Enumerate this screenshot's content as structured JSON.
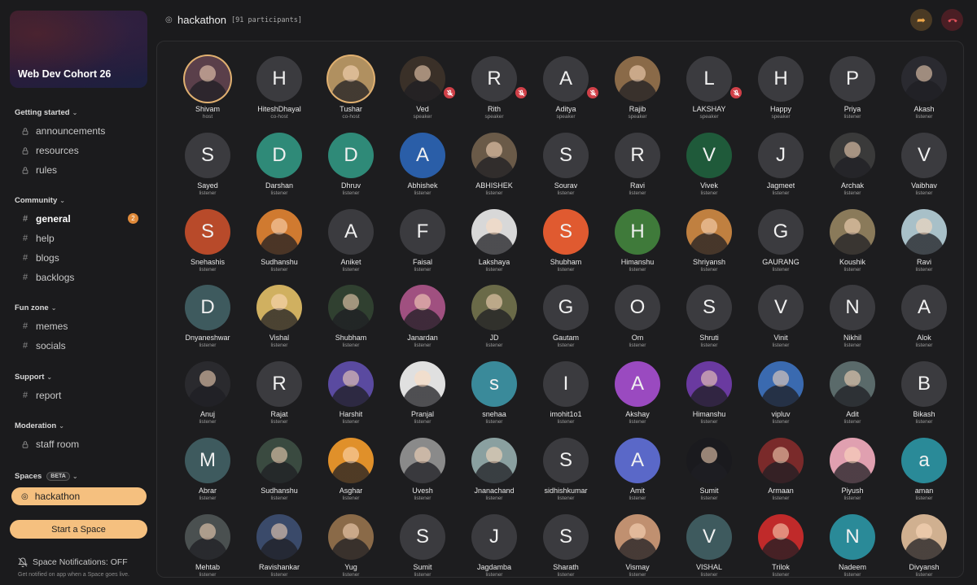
{
  "sidebar": {
    "server_name": "Web Dev Cohort 26",
    "categories": [
      {
        "label": "Getting started",
        "channels": [
          {
            "label": "announcements",
            "icon": "lock-icon"
          },
          {
            "label": "resources",
            "icon": "lock-icon"
          },
          {
            "label": "rules",
            "icon": "lock-icon"
          }
        ]
      },
      {
        "label": "Community",
        "channels": [
          {
            "label": "general",
            "icon": "hash-icon",
            "badge": "2",
            "active": true
          },
          {
            "label": "help",
            "icon": "hash-icon"
          },
          {
            "label": "blogs",
            "icon": "hash-icon"
          },
          {
            "label": "backlogs",
            "icon": "hash-icon"
          }
        ]
      },
      {
        "label": "Fun zone",
        "channels": [
          {
            "label": "memes",
            "icon": "hash-icon"
          },
          {
            "label": "socials",
            "icon": "hash-icon"
          }
        ]
      },
      {
        "label": "Support",
        "channels": [
          {
            "label": "report",
            "icon": "hash-icon"
          }
        ]
      },
      {
        "label": "Moderation",
        "channels": [
          {
            "label": "staff room",
            "icon": "lock-icon"
          }
        ]
      }
    ],
    "spaces": {
      "label": "Spaces",
      "beta": "BETA",
      "items": [
        {
          "label": "hackathon",
          "icon": "broadcast-icon",
          "active": true
        }
      ]
    },
    "start_space_label": "Start a Space",
    "notifications": {
      "label": "Space Notifications: OFF",
      "sub": "Get notified on app when a Space goes live."
    }
  },
  "header": {
    "title": "hackathon",
    "participants": "[91 participants]",
    "share_icon": "share-arrow-icon",
    "leave_icon": "hang-up-icon"
  },
  "colors": {
    "accent": "#f5c07f",
    "badge": "#e08a3a",
    "mute": "#d04048",
    "share": "#f0a94a",
    "hangup": "#e0505a"
  },
  "participants": [
    {
      "name": "Shivam",
      "role": "host",
      "initial": "",
      "photo": true,
      "ring": true,
      "bg": "#5a3f4a"
    },
    {
      "name": "HiteshDhayal",
      "role": "co-host",
      "initial": "H",
      "bg": "#3b3b3f"
    },
    {
      "name": "Tushar",
      "role": "co-host",
      "initial": "",
      "photo": true,
      "ring": true,
      "bg": "#b09060"
    },
    {
      "name": "Ved",
      "role": "speaker",
      "initial": "",
      "photo": true,
      "muted": true,
      "bg": "#3a3028"
    },
    {
      "name": "Rith",
      "role": "speaker",
      "initial": "R",
      "muted": true,
      "bg": "#3b3b3f"
    },
    {
      "name": "Aditya",
      "role": "speaker",
      "initial": "A",
      "muted": true,
      "bg": "#3b3b3f"
    },
    {
      "name": "Rajib",
      "role": "speaker",
      "initial": "",
      "photo": true,
      "bg": "#8a6a48"
    },
    {
      "name": "LAKSHAY",
      "role": "speaker",
      "initial": "L",
      "muted": true,
      "bg": "#3b3b3f"
    },
    {
      "name": "Happy",
      "role": "speaker",
      "initial": "H",
      "bg": "#3b3b3f"
    },
    {
      "name": "Priya",
      "role": "listener",
      "initial": "P",
      "bg": "#3b3b3f"
    },
    {
      "name": "Akash",
      "role": "listener",
      "initial": "",
      "photo": true,
      "bg": "#2a2a30"
    },
    {
      "name": "Sayed",
      "role": "listener",
      "initial": "S",
      "bg": "#3b3b3f"
    },
    {
      "name": "Darshan",
      "role": "listener",
      "initial": "D",
      "bg": "#2f8a78"
    },
    {
      "name": "Dhruv",
      "role": "listener",
      "initial": "D",
      "bg": "#2f8a78"
    },
    {
      "name": "Abhishek",
      "role": "listener",
      "initial": "A",
      "bg": "#2a5ea8"
    },
    {
      "name": "ABHISHEK",
      "role": "listener",
      "initial": "",
      "photo": true,
      "bg": "#6a5a48"
    },
    {
      "name": "Sourav",
      "role": "listener",
      "initial": "S",
      "bg": "#3b3b3f"
    },
    {
      "name": "Ravi",
      "role": "listener",
      "initial": "R",
      "bg": "#3b3b3f"
    },
    {
      "name": "Vivek",
      "role": "listener",
      "initial": "V",
      "bg": "#1f5a3a"
    },
    {
      "name": "Jagmeet",
      "role": "listener",
      "initial": "J",
      "bg": "#3b3b3f"
    },
    {
      "name": "Archak",
      "role": "listener",
      "initial": "",
      "photo": true,
      "bg": "#3a3a3a"
    },
    {
      "name": "Vaibhav",
      "role": "listener",
      "initial": "V",
      "bg": "#3b3b3f"
    },
    {
      "name": "Snehashis",
      "role": "listener",
      "initial": "S",
      "bg": "#b84a2a"
    },
    {
      "name": "Sudhanshu",
      "role": "listener",
      "initial": "",
      "photo": true,
      "bg": "#d07a30"
    },
    {
      "name": "Aniket",
      "role": "listener",
      "initial": "A",
      "bg": "#3b3b3f"
    },
    {
      "name": "Faisal",
      "role": "listener",
      "initial": "F",
      "bg": "#3b3b3f"
    },
    {
      "name": "Lakshaya",
      "role": "listener",
      "initial": "",
      "photo": true,
      "bg": "#d8d8d8"
    },
    {
      "name": "Shubham",
      "role": "listener",
      "initial": "S",
      "bg": "#e05a30"
    },
    {
      "name": "Himanshu",
      "role": "listener",
      "initial": "H",
      "bg": "#3f7a3a"
    },
    {
      "name": "Shriyansh",
      "role": "listener",
      "initial": "",
      "photo": true,
      "bg": "#c08040"
    },
    {
      "name": "GAURANG",
      "role": "listener",
      "initial": "G",
      "bg": "#3b3b3f"
    },
    {
      "name": "Koushik",
      "role": "listener",
      "initial": "",
      "photo": true,
      "bg": "#8a7a5a"
    },
    {
      "name": "Ravi",
      "role": "listener",
      "initial": "",
      "photo": true,
      "bg": "#a8c0c8"
    },
    {
      "name": "Dnyaneshwar",
      "role": "listener",
      "initial": "D",
      "bg": "#3e5a5e"
    },
    {
      "name": "Vishal",
      "role": "listener",
      "initial": "",
      "photo": true,
      "bg": "#d0b060"
    },
    {
      "name": "Shubham",
      "role": "listener",
      "initial": "",
      "photo": true,
      "bg": "#304030"
    },
    {
      "name": "Janardan",
      "role": "listener",
      "initial": "",
      "photo": true,
      "bg": "#a05080"
    },
    {
      "name": "JD",
      "role": "listener",
      "initial": "",
      "photo": true,
      "bg": "#6a6a48"
    },
    {
      "name": "Gautam",
      "role": "listener",
      "initial": "G",
      "bg": "#3b3b3f"
    },
    {
      "name": "Om",
      "role": "listener",
      "initial": "O",
      "bg": "#3b3b3f"
    },
    {
      "name": "Shruti",
      "role": "listener",
      "initial": "S",
      "bg": "#3b3b3f"
    },
    {
      "name": "Vinit",
      "role": "listener",
      "initial": "V",
      "bg": "#3b3b3f"
    },
    {
      "name": "Nikhil",
      "role": "listener",
      "initial": "N",
      "bg": "#3b3b3f"
    },
    {
      "name": "Alok",
      "role": "listener",
      "initial": "A",
      "bg": "#3b3b3f"
    },
    {
      "name": "Anuj",
      "role": "listener",
      "initial": "",
      "photo": true,
      "bg": "#2a2a2e"
    },
    {
      "name": "Rajat",
      "role": "listener",
      "initial": "R",
      "bg": "#3b3b3f"
    },
    {
      "name": "Harshit",
      "role": "listener",
      "initial": "",
      "photo": true,
      "bg": "#5a4aa0"
    },
    {
      "name": "Pranjal",
      "role": "listener",
      "initial": "",
      "photo": true,
      "bg": "#e0e0e0"
    },
    {
      "name": "snehaa",
      "role": "listener",
      "initial": "s",
      "bg": "#3a8a9a"
    },
    {
      "name": "imohit1o1",
      "role": "listener",
      "initial": "I",
      "bg": "#3b3b3f"
    },
    {
      "name": "Akshay",
      "role": "listener",
      "initial": "A",
      "bg": "#9a4ac0"
    },
    {
      "name": "Himanshu",
      "role": "listener",
      "initial": "",
      "photo": true,
      "bg": "#6a3aa0"
    },
    {
      "name": "vipluv",
      "role": "listener",
      "initial": "",
      "photo": true,
      "bg": "#3a6ab0"
    },
    {
      "name": "Adit",
      "role": "listener",
      "initial": "",
      "photo": true,
      "bg": "#5a6a6a"
    },
    {
      "name": "Bikash",
      "role": "listener",
      "initial": "B",
      "bg": "#3b3b3f"
    },
    {
      "name": "Abrar",
      "role": "listener",
      "initial": "M",
      "bg": "#3e5a5e"
    },
    {
      "name": "Sudhanshu",
      "role": "listener",
      "initial": "",
      "photo": true,
      "bg": "#3a4a40"
    },
    {
      "name": "Asghar",
      "role": "listener",
      "initial": "",
      "photo": true,
      "bg": "#e0902a"
    },
    {
      "name": "Uvesh",
      "role": "listener",
      "initial": "",
      "photo": true,
      "bg": "#8a8a8a"
    },
    {
      "name": "Jnanachand",
      "role": "listener",
      "initial": "",
      "photo": true,
      "bg": "#8aa0a0"
    },
    {
      "name": "sidhishkumar",
      "role": "listener",
      "initial": "S",
      "bg": "#3b3b3f"
    },
    {
      "name": "Amit",
      "role": "listener",
      "initial": "A",
      "bg": "#5a68c8"
    },
    {
      "name": "Sumit",
      "role": "listener",
      "initial": "",
      "photo": true,
      "bg": "#1a1a1e"
    },
    {
      "name": "Armaan",
      "role": "listener",
      "initial": "",
      "photo": true,
      "bg": "#7a2a2a"
    },
    {
      "name": "Piyush",
      "role": "listener",
      "initial": "",
      "photo": true,
      "bg": "#e0a0b0"
    },
    {
      "name": "aman",
      "role": "listener",
      "initial": "a",
      "bg": "#2a8a98"
    },
    {
      "name": "Mehtab",
      "role": "listener",
      "initial": "",
      "photo": true,
      "bg": "#4a5050"
    },
    {
      "name": "Ravishankar",
      "role": "listener",
      "initial": "",
      "photo": true,
      "bg": "#3a4a6a"
    },
    {
      "name": "Yug",
      "role": "listener",
      "initial": "",
      "photo": true,
      "bg": "#8a6a48"
    },
    {
      "name": "Sumit",
      "role": "listener",
      "initial": "S",
      "bg": "#3b3b3f"
    },
    {
      "name": "Jagdamba",
      "role": "listener",
      "initial": "J",
      "bg": "#3b3b3f"
    },
    {
      "name": "Sharath",
      "role": "listener",
      "initial": "S",
      "bg": "#3b3b3f"
    },
    {
      "name": "Vismay",
      "role": "listener",
      "initial": "",
      "photo": true,
      "bg": "#c09070"
    },
    {
      "name": "VISHAL",
      "role": "listener",
      "initial": "V",
      "bg": "#3e5a5e"
    },
    {
      "name": "Trilok",
      "role": "listener",
      "initial": "",
      "photo": true,
      "bg": "#c02a2a"
    },
    {
      "name": "Nadeem",
      "role": "listener",
      "initial": "N",
      "bg": "#2a8a98"
    },
    {
      "name": "Divyansh",
      "role": "listener",
      "initial": "",
      "photo": true,
      "bg": "#d0b090"
    }
  ]
}
